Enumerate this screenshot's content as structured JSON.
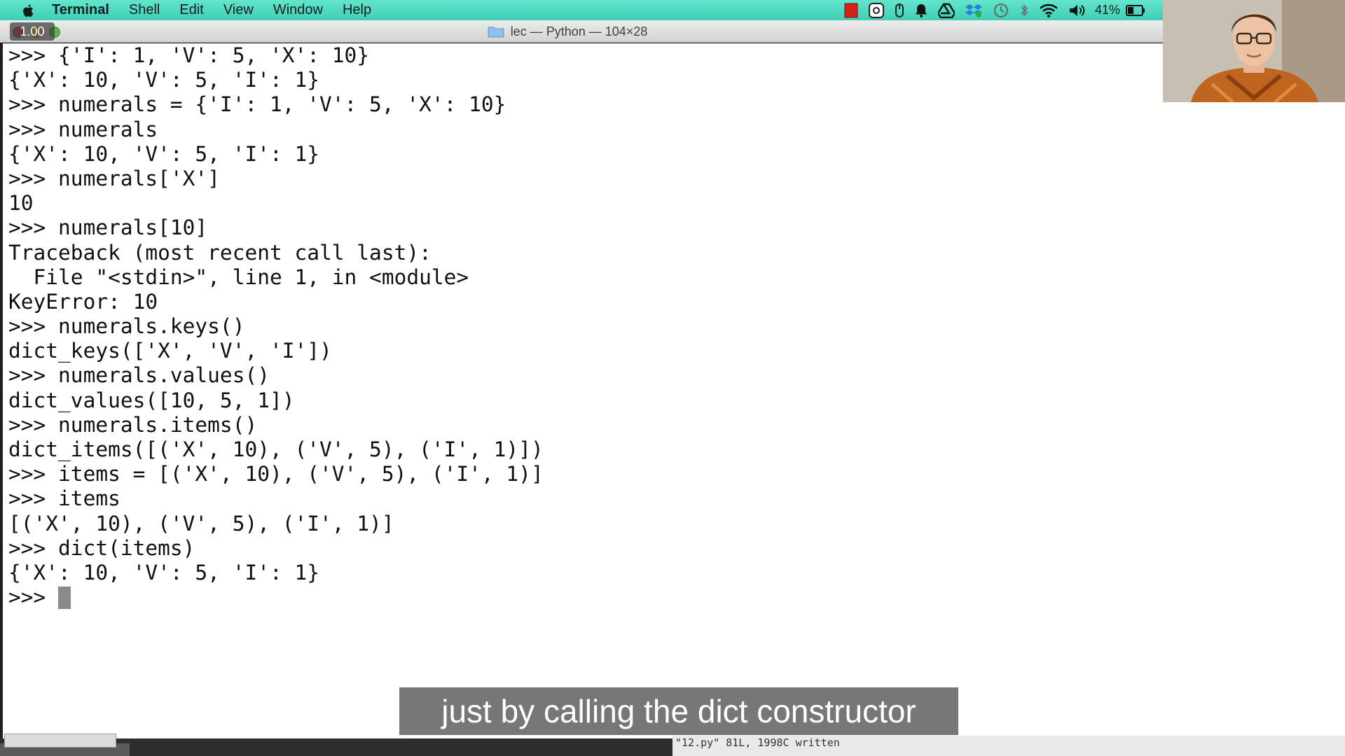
{
  "menubar": {
    "app_name": "Terminal",
    "items": [
      "Shell",
      "Edit",
      "View",
      "Window",
      "Help"
    ],
    "status_icons": [
      "red-square-icon",
      "steam-icon",
      "mouse-icon",
      "bell-icon",
      "google-drive-icon",
      "dropbox-icon",
      "time-machine-icon",
      "bluetooth-icon",
      "wifi-icon",
      "volume-icon",
      "battery-icon"
    ],
    "battery_percent": "41%"
  },
  "window": {
    "title": "lec — Python — 104×28",
    "playback_speed": "1.00"
  },
  "terminal": {
    "lines": [
      ">>> {'I': 1, 'V': 5, 'X': 10}",
      "{'X': 10, 'V': 5, 'I': 1}",
      ">>> numerals = {'I': 1, 'V': 5, 'X': 10}",
      ">>> numerals",
      "{'X': 10, 'V': 5, 'I': 1}",
      ">>> numerals['X']",
      "10",
      ">>> numerals[10]",
      "Traceback (most recent call last):",
      "  File \"<stdin>\", line 1, in <module>",
      "KeyError: 10",
      ">>> numerals.keys()",
      "dict_keys(['X', 'V', 'I'])",
      ">>> numerals.values()",
      "dict_values([10, 5, 1])",
      ">>> numerals.items()",
      "dict_items([('X', 10), ('V', 5), ('I', 1)])",
      ">>> items = [('X', 10), ('V', 5), ('I', 1)]",
      ">>> items",
      "[('X', 10), ('V', 5), ('I', 1)]",
      ">>> dict(items)",
      "{'X': 10, 'V': 5, 'I': 1}"
    ],
    "prompt": ">>>"
  },
  "background_window": {
    "vim_status": "\"12.py\" 81L, 1998C written"
  },
  "subtitle": "just by calling the dict constructor",
  "colors": {
    "menubar": "#4fd9c0",
    "terminal_bg": "#ffffff",
    "terminal_text": "#101010"
  }
}
